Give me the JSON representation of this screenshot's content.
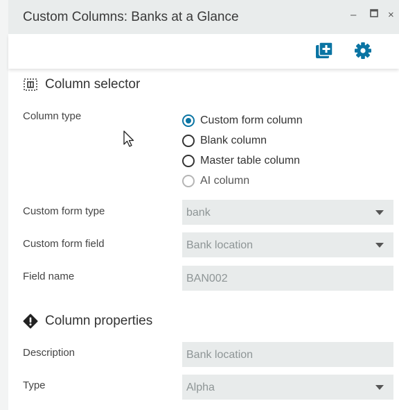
{
  "window": {
    "title": "Custom Columns: Banks at a Glance",
    "minimize_icon": "minimize-icon",
    "maximize_icon": "maximize-icon",
    "close_icon": "close-icon"
  },
  "toolbar": {
    "add_icon": "add-column-icon",
    "settings_icon": "gear-icon",
    "accent_color": "#0a74a3"
  },
  "column_selector": {
    "heading": "Column selector",
    "icon": "column-selector-icon",
    "column_type_label": "Column type",
    "options": [
      {
        "label": "Custom form column",
        "selected": true,
        "enabled": true
      },
      {
        "label": "Blank column",
        "selected": false,
        "enabled": true
      },
      {
        "label": "Master table column",
        "selected": false,
        "enabled": true
      },
      {
        "label": "AI column",
        "selected": false,
        "enabled": false
      }
    ],
    "custom_form_type_label": "Custom form type",
    "custom_form_type_value": "bank",
    "custom_form_field_label": "Custom form field",
    "custom_form_field_value": "Bank location",
    "field_name_label": "Field name",
    "field_name_value": "BAN002"
  },
  "column_properties": {
    "heading": "Column properties",
    "icon": "exclamation-icon",
    "description_label": "Description",
    "description_value": "Bank location",
    "type_label": "Type",
    "type_value": "Alpha"
  }
}
